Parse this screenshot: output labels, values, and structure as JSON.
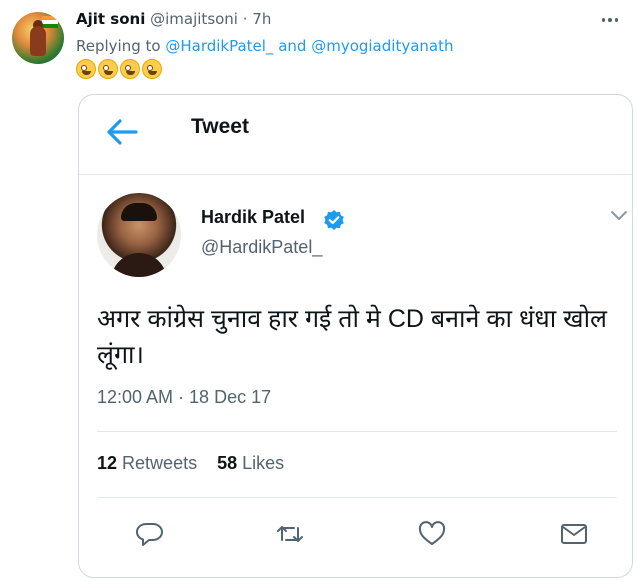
{
  "reply_tweet": {
    "author_name": "Ajit soni",
    "author_handle": "@imajitsoni",
    "separator": " · ",
    "time_ago": "7h",
    "replying_to_prefix": "Replying to ",
    "mention_1": "@HardikPatel_",
    "mention_joiner": " and ",
    "mention_2": "@myogiadityanath",
    "emoji_count": 4,
    "emoji_icon": "zany-face-emoji"
  },
  "embedded_screenshot": {
    "header_title": "Tweet",
    "author_name": "Hardik Patel",
    "author_handle": "@HardikPatel_",
    "verified": true,
    "text": "अगर कांग्रेस चुनाव हार गई तो मे CD बनाने का धंधा खोल लूंगा।",
    "timestamp": "12:00 AM · 18 Dec 17",
    "retweets_count": "12",
    "retweets_label": "Retweets",
    "likes_count": "58",
    "likes_label": "Likes",
    "actions": [
      "reply-icon",
      "retweet-icon",
      "like-icon",
      "share-icon"
    ]
  },
  "colors": {
    "accent_blue": "#1d9bf0",
    "text_primary": "#0f1419",
    "text_secondary": "#536471",
    "border": "#cfd9de"
  }
}
